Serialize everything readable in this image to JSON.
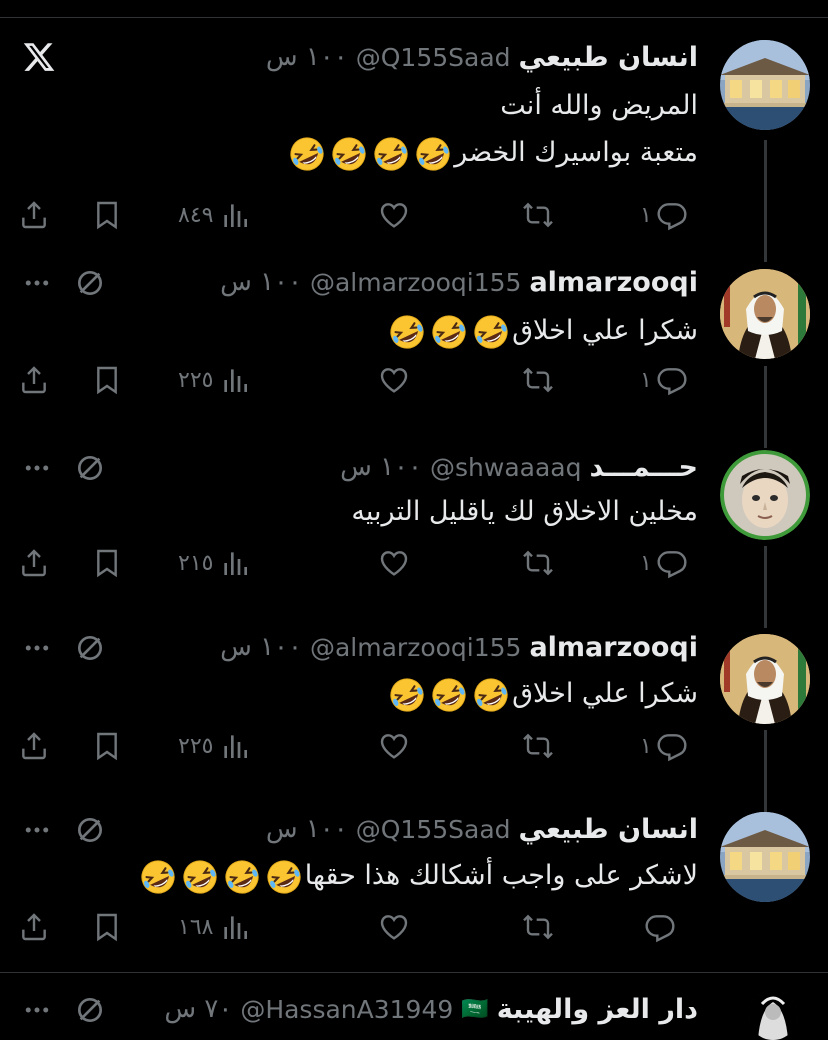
{
  "app": {
    "logo": "x-logo-icon"
  },
  "tweets": [
    {
      "name": "انسان طبيعي",
      "handle": "@Q155Saad",
      "time": "١٠٠ س",
      "lines": [
        "المريض والله أنت",
        "متعبة بواسيرك الخضر"
      ],
      "emoji_count": [
        0,
        4
      ],
      "reply_count": "١",
      "views": "٨٤٩",
      "avatar": "villa-avatar",
      "show_top_icons": false
    },
    {
      "name": "almarzooqi",
      "handle": "@almarzooqi155",
      "time": "١٠٠ س",
      "lines": [
        "شكرا علي اخلاق"
      ],
      "emoji_count": [
        3
      ],
      "reply_count": "١",
      "views": "٢٢٥",
      "avatar": "portrait-avatar",
      "show_top_icons": true
    },
    {
      "name": "حـــمـــد",
      "handle": "@shwaaaaq",
      "time": "١٠٠ س",
      "lines": [
        "مخلين الاخلاق لك ياقليل التربيه"
      ],
      "emoji_count": [
        0
      ],
      "reply_count": "١",
      "views": "٢١٥",
      "avatar": "child-avatar",
      "show_top_icons": true
    },
    {
      "name": "almarzooqi",
      "handle": "@almarzooqi155",
      "time": "١٠٠ س",
      "lines": [
        "شكرا علي اخلاق"
      ],
      "emoji_count": [
        3
      ],
      "reply_count": "١",
      "views": "٢٢٥",
      "avatar": "portrait-avatar",
      "show_top_icons": true
    },
    {
      "name": "انسان طبيعي",
      "handle": "@Q155Saad",
      "time": "١٠٠ س",
      "lines": [
        "لاشكر على واجب أشكالك هذا حقها"
      ],
      "emoji_count": [
        4
      ],
      "reply_count": "",
      "views": "١٦٨",
      "avatar": "villa-avatar",
      "show_top_icons": true
    }
  ],
  "bottom_tweet": {
    "name": "دار العز والهيبة",
    "flag": "🇸🇦",
    "handle": "@HassanA31949",
    "time": "٧٠ س"
  },
  "colors": {
    "background": "#000000",
    "text": "#e7e9ea",
    "muted": "#71767b",
    "line": "#2f3336",
    "green_ring": "#3f9a3a"
  }
}
